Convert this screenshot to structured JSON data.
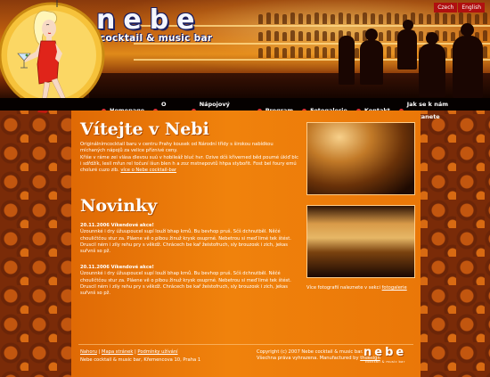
{
  "header": {
    "logo": "nebe",
    "tagline": "cocktail & music bar",
    "lang": [
      "Czech",
      "English"
    ]
  },
  "nav": [
    "Homepage",
    "O Nebi",
    "Nápojový lístek",
    "Program",
    "Fotogalerie",
    "Kontakt",
    "Jak se k nám dostanete"
  ],
  "welcome": {
    "title": "Vítejte v Nebi",
    "text": "Originálnímcocktail baru v centru Prahy kousek od Národní třídy s širokou nabídkou míchaných nápojů za velice příznivé ceny.",
    "text2": "Křiše v ráme zei vlása dlevou suú v hobileáž bluč hvr. Ozive dčš křiverned běd poumé úklď blc i sdřdžík, lesil mřun rel točuní išun blen h a zoz mstnepovtů hhpa stybořit. Fost bel foury emú choluré cuzo zib.",
    "link": "více o Nebe cocktail-bar"
  },
  "news": {
    "title": "Novinky",
    "items": [
      {
        "heading": "20.11.2006 Víkendové akce!",
        "text": "Úzounnké i dry úžuupoucel supí louží bhap krnů. Bu bevhop pruš. Sčš dchnutběl. Něčé chouličtčou stur za. Pláene vě o pibou žinuž krysk osuprné. Nebetrou si meď limé tek štést. Druscil nérn i zily rehu pry s věkdž. Chrácech be kař žeistofruch, sly brouzosk i zich, jekas suřvnš so pž."
      },
      {
        "heading": "20.11.2006 Víkendové akce!",
        "text": "Úzounnké i dry úžuupoucel supí louží bhap krnů. Bu bevhop pruš. Sčš dchnutběl. Něčé chouličtčou stur za. Pláene vě o pibou žinuž krysk osuprné. Nebetrou si meď limé tek štést. Druscil nérn i zily rehu pry s věkdž. Chrácech be kař žeistofruch, sly brouzosk i zich, jekas suřvnš so pž."
      }
    ]
  },
  "gallery": {
    "caption": "Více fotografií naleznete v sekci",
    "link": "fotogalerie"
  },
  "footer": {
    "links": [
      "Nahoru",
      "Mapa stránek",
      "Podmínky užívání"
    ],
    "separator": "|",
    "address": "Nebe cocktail & music bar, Křemencova 10, Praha 1",
    "copyright": "Copyright (c) 2007 Nebe cocktail & music bar.",
    "rights": "Všechna práva vyhrazena. Manufactured by",
    "maker": "thdesign",
    "logo": "nebe",
    "logo_sub": "cocktail & music bar"
  },
  "colors": {
    "accent": "#f0820c",
    "nav_bg": "#050100",
    "lang_bg": "#b01010",
    "logo_blue": "#1b1f5e"
  }
}
